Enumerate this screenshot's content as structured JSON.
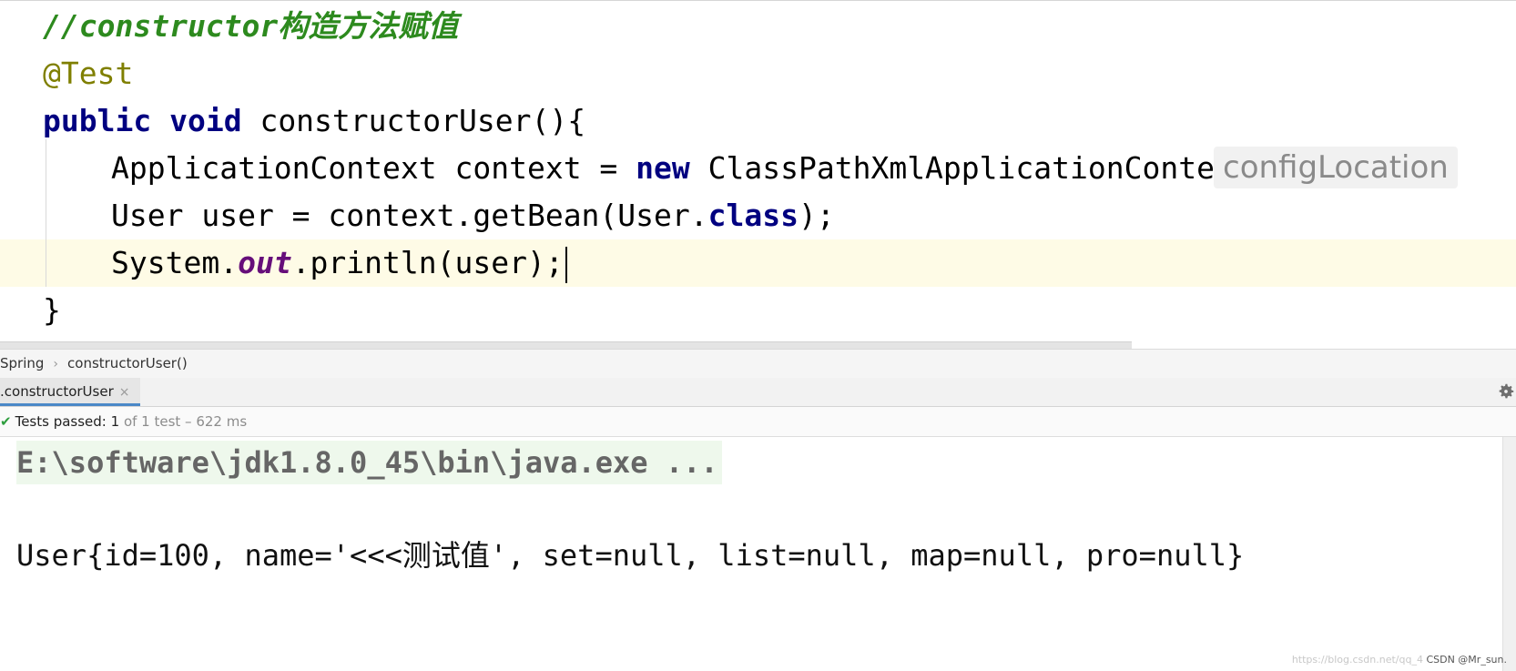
{
  "editor": {
    "comment": "//constructor构造方法赋值",
    "annotation": "@Test",
    "kw_public": "public",
    "kw_void": "void",
    "method_sig": " constructorUser(){",
    "line4_pre": "ApplicationContext context = ",
    "kw_new": "new",
    "line4_post": " ClassPathXmlApplicationContext(",
    "param_hint": "configLocation",
    "line5_pre": "User user = context.getBean(User.",
    "kw_class": "class",
    "line5_post": ");",
    "line6_pre": "System.",
    "line6_field": "out",
    "line6_post": ".println(user);",
    "closing_brace": "}"
  },
  "breadcrumb": {
    "items": [
      "Spring",
      "constructorUser()"
    ]
  },
  "run_tab": {
    "label": ".constructorUser",
    "close": "×"
  },
  "test_status": {
    "prefix": "Tests passed: ",
    "passed": "1",
    "rest": " of 1 test – 622 ms"
  },
  "console": {
    "command": "E:\\software\\jdk1.8.0_45\\bin\\java.exe ...",
    "output": "User{id=100, name='<<<测试值', set=null, list=null, map=null, pro=null}"
  },
  "watermark": {
    "text": "https://blog.csdn.net/qq_4",
    "credit": "CSDN @Mr_sun."
  }
}
